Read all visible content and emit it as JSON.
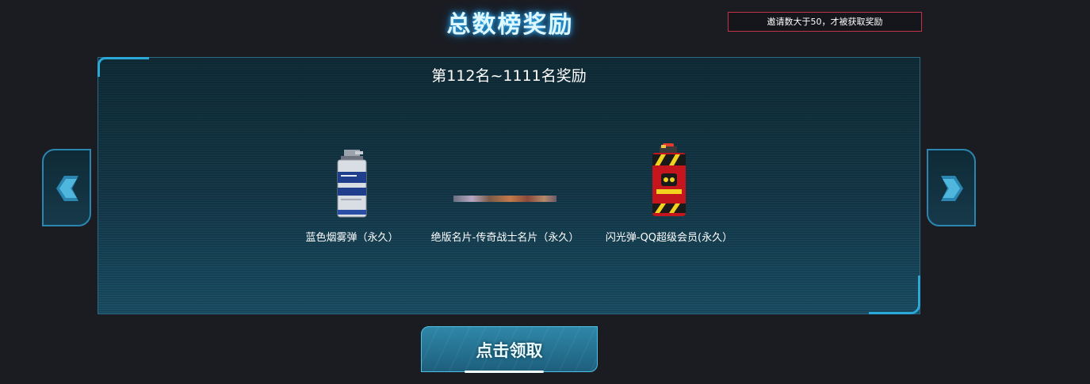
{
  "header": {
    "title": "总数榜奖励",
    "notice": "邀请数大于50，才被获取奖励"
  },
  "panel": {
    "heading": "第112名~1111名奖励",
    "rewards": [
      {
        "label": "蓝色烟雾弹（永久）",
        "icon": "blue-smoke-grenade-icon"
      },
      {
        "label": "绝版名片-传奇战士名片（永久）",
        "icon": "legendary-warrior-namecard-icon"
      },
      {
        "label": "闪光弹-QQ超级会员(永久）",
        "icon": "red-flashbang-icon"
      }
    ]
  },
  "navigation": {
    "prev_icon": "chevron-left-icon",
    "next_icon": "chevron-right-icon"
  },
  "claim": {
    "label": "点击领取"
  },
  "colors": {
    "background": "#1a1c22",
    "accent": "#2aa8d8",
    "notice_border": "#c2334a"
  }
}
